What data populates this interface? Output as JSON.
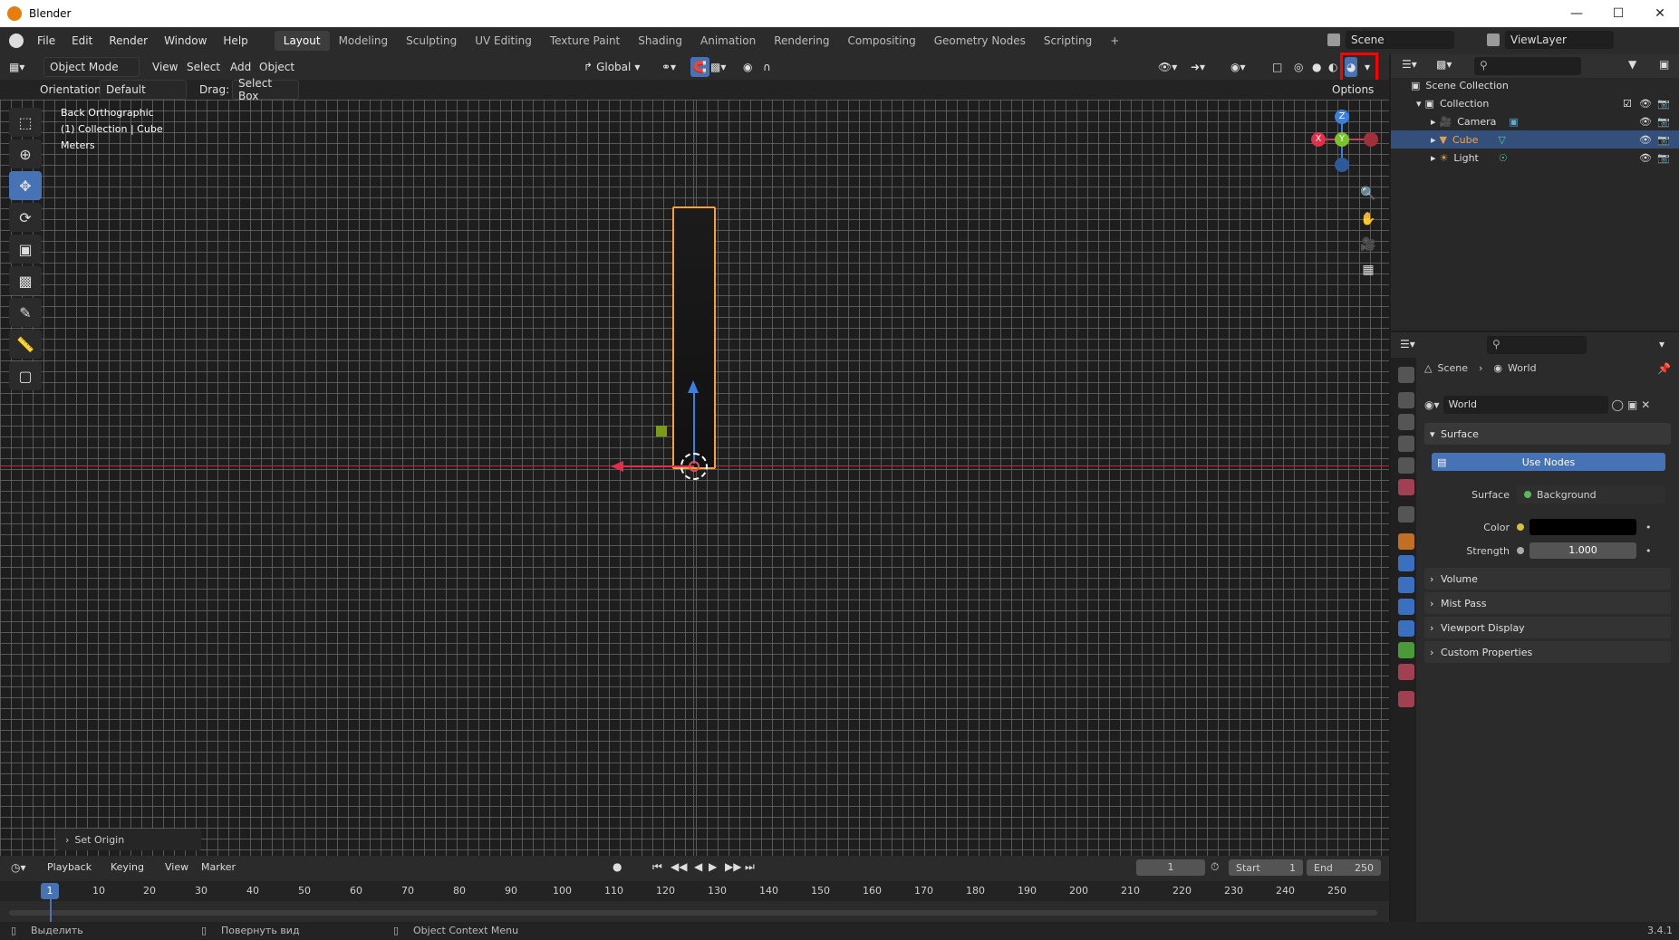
{
  "window": {
    "title": "Blender"
  },
  "menu": {
    "items": [
      "File",
      "Edit",
      "Render",
      "Window",
      "Help"
    ]
  },
  "workspaces": [
    "Layout",
    "Modeling",
    "Sculpting",
    "UV Editing",
    "Texture Paint",
    "Shading",
    "Animation",
    "Rendering",
    "Compositing",
    "Geometry Nodes",
    "Scripting",
    "+"
  ],
  "scene": {
    "name": "Scene",
    "view_layer": "ViewLayer"
  },
  "viewport_header": {
    "mode": "Object Mode",
    "menus": [
      "View",
      "Select",
      "Add",
      "Object"
    ],
    "transform": "Global",
    "orientation_label": "Orientation:",
    "orientation_value": "Default",
    "drag_label": "Drag:",
    "drag_value": "Select Box",
    "options": "Options"
  },
  "viewport_info": {
    "view": "Back Orthographic",
    "collection": "(1) Collection | Cube",
    "units": "Meters"
  },
  "operator_panel": "Set Origin",
  "outliner": {
    "root": "Scene Collection",
    "collection": "Collection",
    "items": [
      {
        "name": "Camera",
        "selected": false
      },
      {
        "name": "Cube",
        "selected": true
      },
      {
        "name": "Light",
        "selected": false
      }
    ]
  },
  "properties": {
    "breadcrumb_scene": "Scene",
    "breadcrumb_world": "World",
    "world_name": "World",
    "surface_panel": "Surface",
    "use_nodes": "Use Nodes",
    "surface_label": "Surface",
    "surface_value": "Background",
    "color_label": "Color",
    "strength_label": "Strength",
    "strength_value": "1.000",
    "panels": [
      "Volume",
      "Mist Pass",
      "Viewport Display",
      "Custom Properties"
    ]
  },
  "timeline": {
    "menus": [
      "Playback",
      "Keying",
      "View",
      "Marker"
    ],
    "current_frame": "1",
    "start_label": "Start",
    "start_value": "1",
    "end_label": "End",
    "end_value": "250",
    "ticks": [
      "1",
      "10",
      "20",
      "30",
      "40",
      "50",
      "60",
      "70",
      "80",
      "90",
      "100",
      "110",
      "120",
      "130",
      "140",
      "150",
      "160",
      "170",
      "180",
      "190",
      "200",
      "210",
      "220",
      "230",
      "240",
      "250"
    ]
  },
  "statusbar": {
    "select": "Выделить",
    "rotate": "Повернуть вид",
    "context": "Object Context Menu",
    "version": "3.4.1"
  },
  "colors": {
    "accent": "#4772b3",
    "selection_outline": "#f5a142",
    "x_axis": "#e0304a",
    "y_axis": "#7ac32b",
    "z_axis": "#3b7fe0",
    "highlight_box": "#ff0000"
  }
}
